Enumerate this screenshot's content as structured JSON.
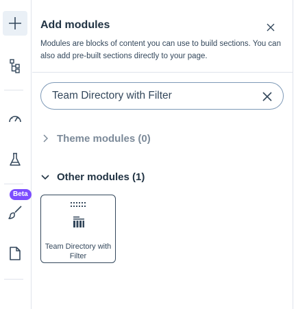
{
  "rail": {
    "items": [
      {
        "id": "add",
        "icon": "plus-icon"
      },
      {
        "id": "layers",
        "icon": "tree-structure-icon"
      },
      {
        "id": "optimize",
        "icon": "gauge-icon"
      },
      {
        "id": "test",
        "icon": "flask-icon"
      },
      {
        "id": "design",
        "icon": "paintbrush-icon"
      },
      {
        "id": "page",
        "icon": "page-icon"
      }
    ],
    "beta_label": "Beta"
  },
  "panel": {
    "title": "Add modules",
    "description": "Modules are blocks of content you can use to build sections. You can also add pre-built sections directly to your page.",
    "search": {
      "value": "Team Directory with Filter"
    },
    "sections": [
      {
        "label": "Theme modules (0)",
        "expanded": false
      },
      {
        "label": "Other modules (1)",
        "expanded": true
      }
    ],
    "modules": [
      {
        "label": "Team Directory with Filter",
        "icon": "table-grid-icon"
      }
    ]
  },
  "colors": {
    "text": "#33475b",
    "heading": "#213343",
    "muted": "#7c8a99",
    "border": "#dfe3eb",
    "beta": "#7c4dff"
  }
}
